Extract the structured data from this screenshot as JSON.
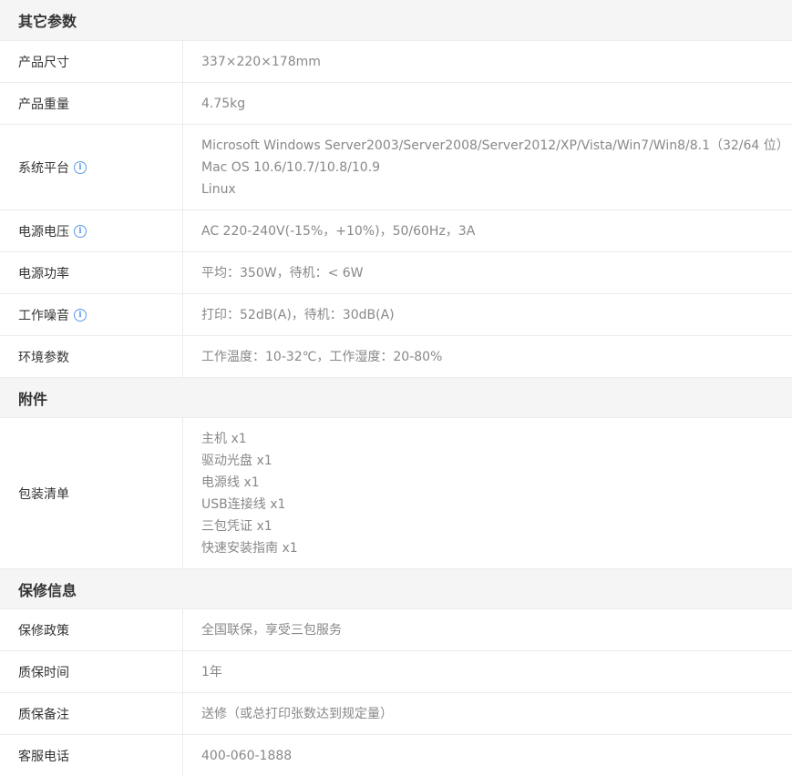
{
  "sections": [
    {
      "title": "其它参数",
      "rows": [
        {
          "label": "产品尺寸",
          "info": false,
          "lines": [
            "337×220×178mm"
          ]
        },
        {
          "label": "产品重量",
          "info": false,
          "lines": [
            "4.75kg"
          ]
        },
        {
          "label": "系统平台",
          "info": true,
          "lines": [
            "Microsoft Windows Server2003/Server2008/Server2012/XP/Vista/Win7/Win8/8.1（32/64 位）",
            "Mac OS 10.6/10.7/10.8/10.9",
            "Linux"
          ]
        },
        {
          "label": "电源电压",
          "info": true,
          "lines": [
            "AC 220-240V(-15%，+10%)，50/60Hz，3A"
          ]
        },
        {
          "label": "电源功率",
          "info": false,
          "lines": [
            "平均：350W，待机：< 6W"
          ]
        },
        {
          "label": "工作噪音",
          "info": true,
          "lines": [
            "打印：52dB(A)，待机：30dB(A)"
          ]
        },
        {
          "label": "环境参数",
          "info": false,
          "lines": [
            "工作温度：10-32℃，工作湿度：20-80%"
          ]
        }
      ]
    },
    {
      "title": "附件",
      "rows": [
        {
          "label": "包装清单",
          "info": false,
          "lines": [
            "主机 x1",
            "驱动光盘 x1",
            "电源线 x1",
            "USB连接线 x1",
            "三包凭证 x1",
            "快速安装指南 x1"
          ]
        }
      ]
    },
    {
      "title": "保修信息",
      "rows": [
        {
          "label": "保修政策",
          "info": false,
          "lines": [
            "全国联保，享受三包服务"
          ]
        },
        {
          "label": "质保时间",
          "info": false,
          "lines": [
            "1年"
          ]
        },
        {
          "label": "质保备注",
          "info": false,
          "lines": [
            "送修（或总打印张数达到规定量）"
          ]
        },
        {
          "label": "客服电话",
          "info": false,
          "lines": [
            "400-060-1888"
          ]
        }
      ]
    }
  ],
  "icons": {
    "info": "info-icon"
  },
  "colors": {
    "info_icon": "#5a9be6",
    "header_bg": "#f5f5f5",
    "value_text": "#888888",
    "label_text": "#333333"
  }
}
